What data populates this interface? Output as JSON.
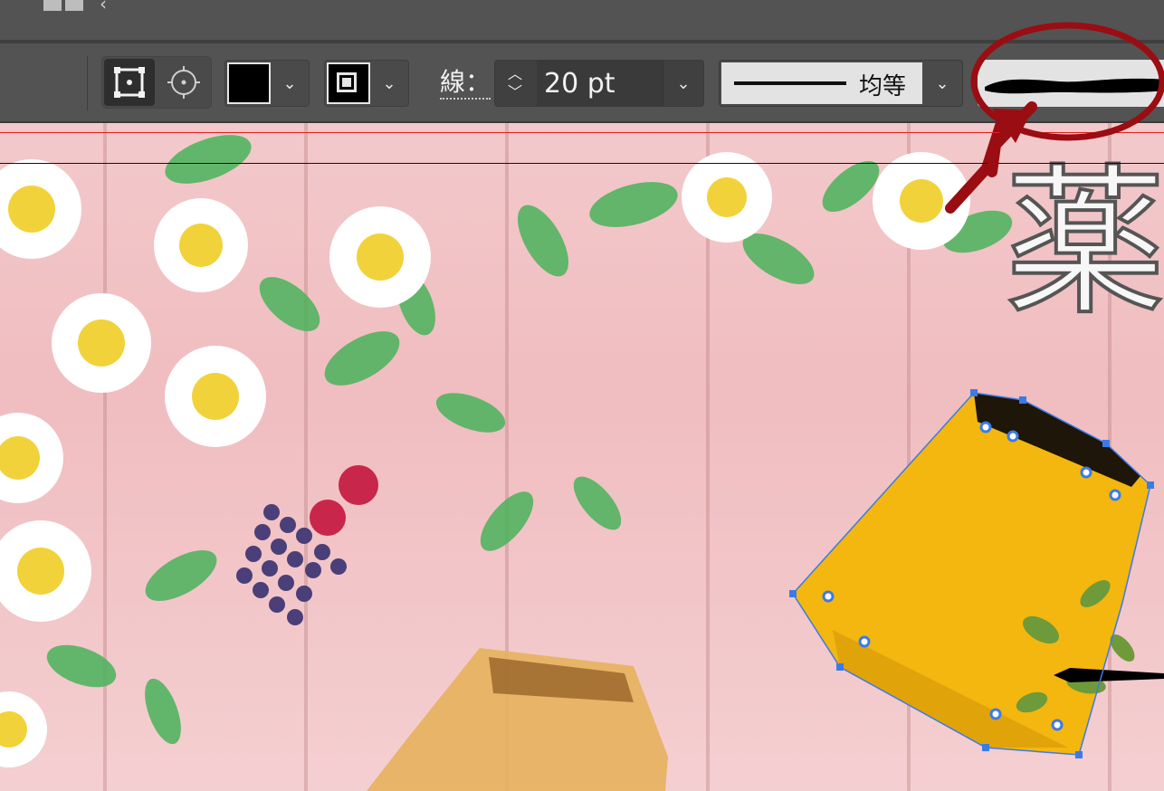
{
  "stroke": {
    "label": "線：",
    "weight_value": "20 pt"
  },
  "profile": {
    "label": "均等"
  },
  "canvas": {
    "title_glyph": "薬"
  },
  "colors": {
    "panel_bg": "#535353",
    "fill_swatch": "#000000",
    "selection": "#3b7be8",
    "annotation": "#9a0d12"
  }
}
